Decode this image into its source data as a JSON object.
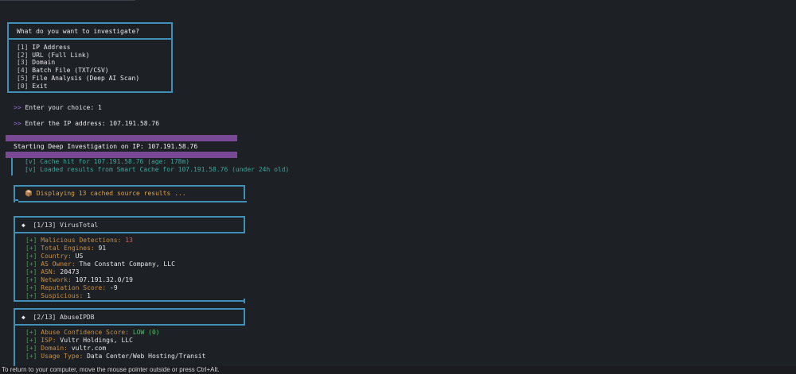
{
  "menu": {
    "title": "What do you want to investigate?",
    "items": [
      {
        "key": "[1]",
        "label": "IP Address"
      },
      {
        "key": "[2]",
        "label": "URL (Full Link)"
      },
      {
        "key": "[3]",
        "label": "Domain"
      },
      {
        "key": "[4]",
        "label": "Batch File (TXT/CSV)"
      },
      {
        "key": "[5]",
        "label": "File Analysis (Deep AI Scan)"
      },
      {
        "key": "[0]",
        "label": "Exit"
      }
    ]
  },
  "prompts": {
    "arrow": ">>",
    "choice": "Enter your choice: 1",
    "ip": "Enter the IP address: 107.191.58.76"
  },
  "banner": {
    "text": "Starting Deep Investigation on IP: 107.191.58.76"
  },
  "cache": {
    "mark": "[v]",
    "lines": [
      "Cache hit for 107.191.58.76 (age: 178m)",
      "Loaded results from Smart Cache for 107.191.58.76 (under 24h old)"
    ]
  },
  "displaying": {
    "icon": "package-icon",
    "icon_glyph": "📦",
    "text": "Displaying 13 cached source results ..."
  },
  "sources": [
    {
      "header": "[1/13] VirusTotal",
      "fields": [
        {
          "label": "Malicious Detections:",
          "value": "13",
          "color": "#e05a5a"
        },
        {
          "label": "Total Engines:",
          "value": "91"
        },
        {
          "label": "Country:",
          "value": "US"
        },
        {
          "label": "AS Owner:",
          "value": "The Constant Company, LLC"
        },
        {
          "label": "ASN:",
          "value": "20473"
        },
        {
          "label": "Network:",
          "value": "107.191.32.0/19"
        },
        {
          "label": "Reputation Score:",
          "value": "-9"
        },
        {
          "label": "Suspicious:",
          "value": "1"
        }
      ]
    },
    {
      "header": "[2/13] AbuseIPDB",
      "fields": [
        {
          "label": "Abuse Confidence Score:",
          "value": "LOW (0)",
          "color": "#4fc06a"
        },
        {
          "label": "ISP:",
          "value": "Vultr Holdings, LLC"
        },
        {
          "label": "Domain:",
          "value": "vultr.com"
        },
        {
          "label": "Usage Type:",
          "value": "Data Center/Web Hosting/Transit"
        }
      ]
    }
  ],
  "plus_mark": "[+]",
  "diamond": "◆",
  "footer": "To return to your computer, move the mouse pointer outside or press Ctrl+Alt."
}
